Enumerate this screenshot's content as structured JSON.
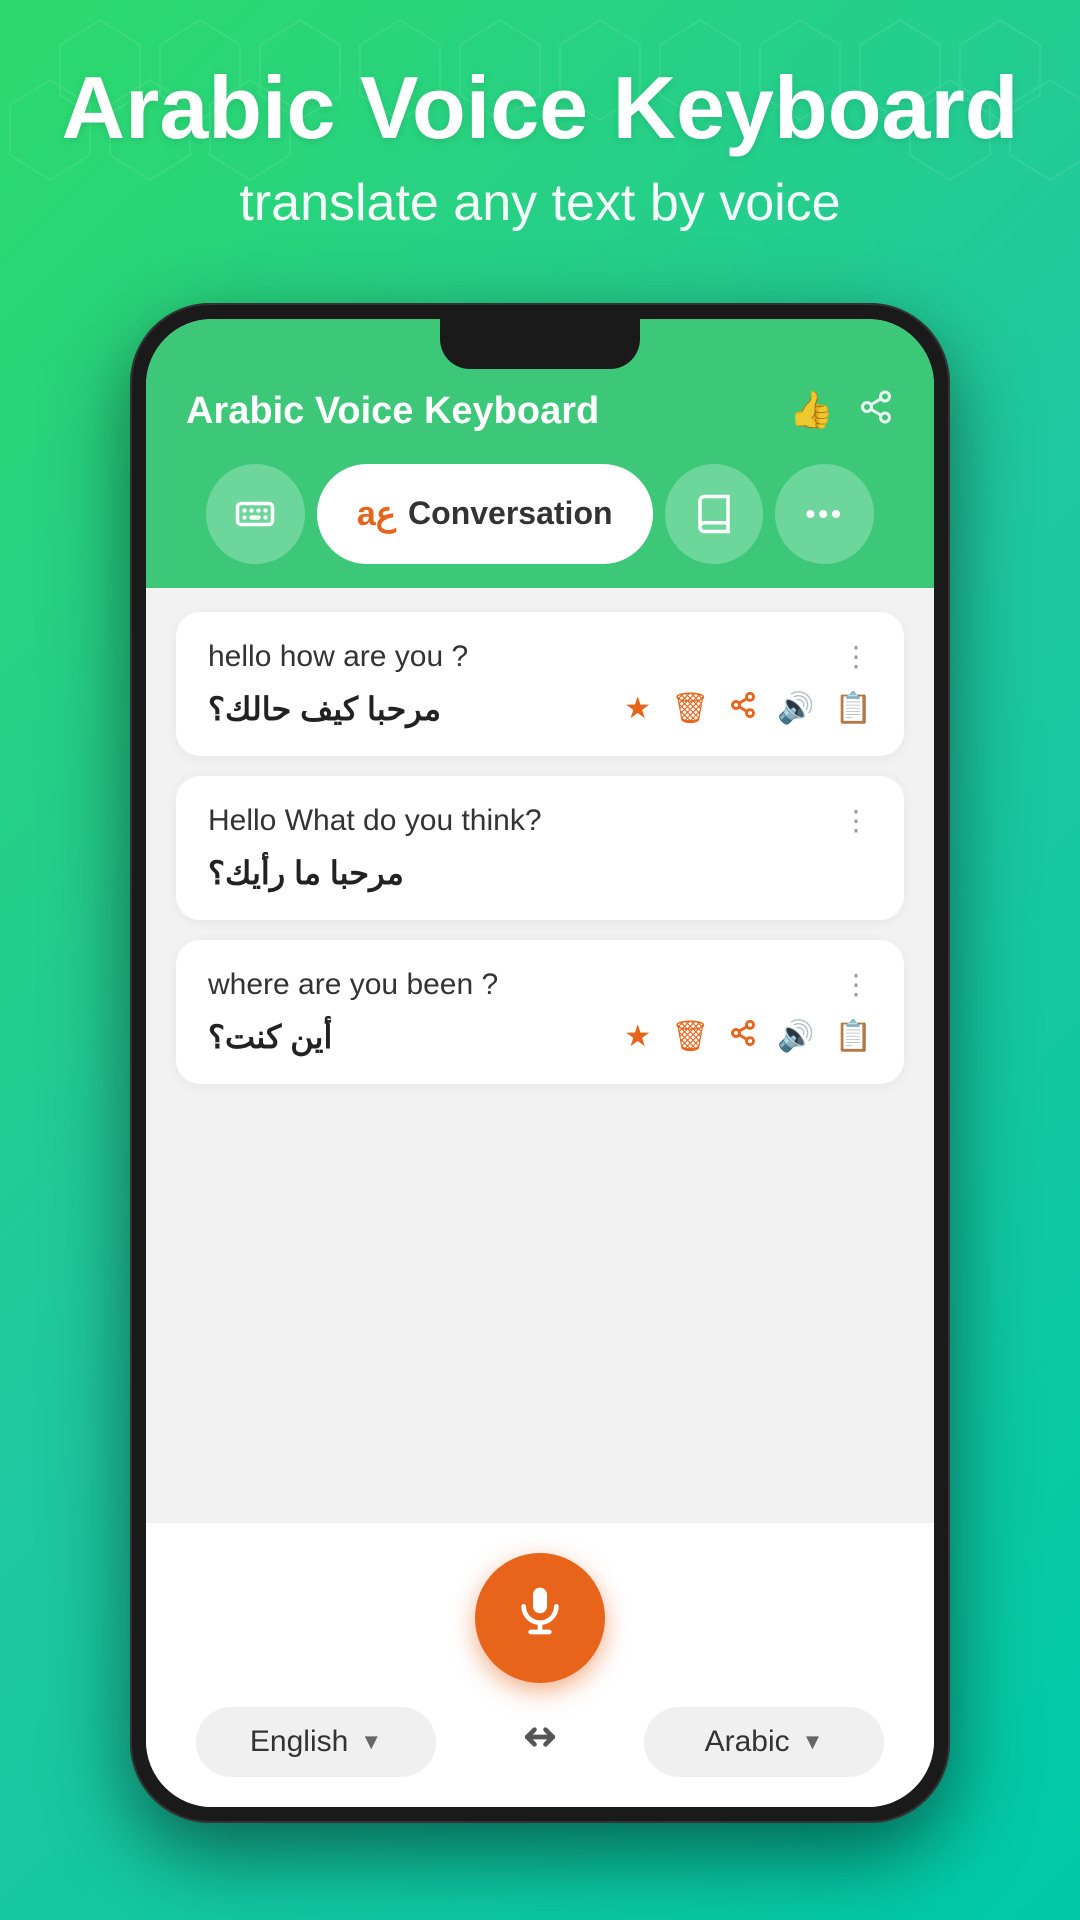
{
  "hero": {
    "title": "Arabic Voice Keyboard",
    "subtitle": "translate any text by voice"
  },
  "app": {
    "title": "Arabic Voice Keyboard",
    "tabs": [
      {
        "id": "keyboard",
        "icon": "⌨",
        "label": ""
      },
      {
        "id": "conversation",
        "icon": "aع",
        "label": "Conversation",
        "active": true
      },
      {
        "id": "book",
        "icon": "📖",
        "label": ""
      },
      {
        "id": "more",
        "icon": "•••",
        "label": ""
      }
    ],
    "translations": [
      {
        "source": "hello how are you ?",
        "translated": "مرحبا كيف حالك؟",
        "has_actions": true
      },
      {
        "source": "Hello What do you think?",
        "translated": "مرحبا ما رأيك؟",
        "has_actions": false
      },
      {
        "source": "where are you been ?",
        "translated": "أين كنت؟",
        "has_actions": true
      }
    ],
    "source_language": "English",
    "target_language": "Arabic"
  }
}
